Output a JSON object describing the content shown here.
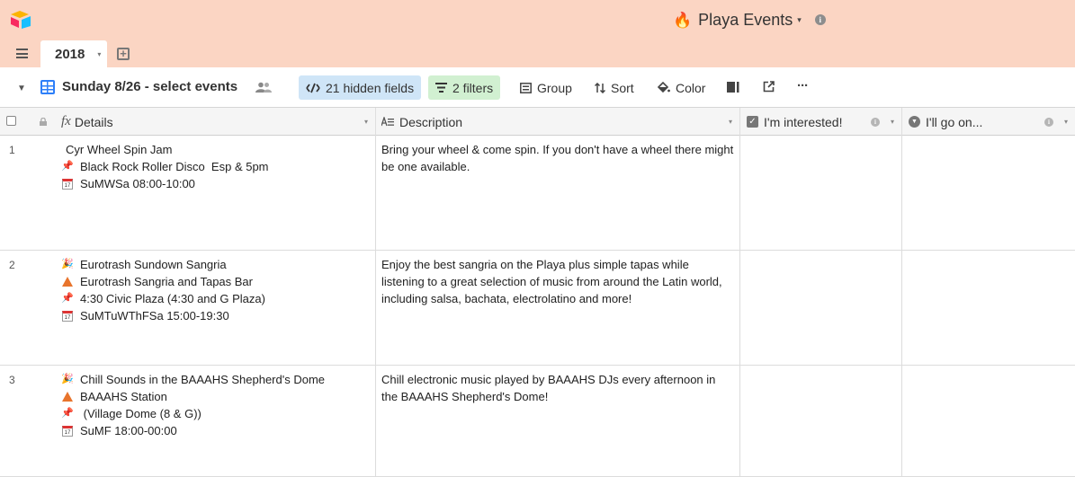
{
  "app": {
    "base_title": "Playa Events",
    "fire_emoji": "🔥",
    "caret": "▾",
    "info": "i"
  },
  "tabs": [
    {
      "label": "2018",
      "caret": "▾"
    }
  ],
  "add_table": "+",
  "view": {
    "collapse": "▼",
    "name": "Sunday 8/26 - select events",
    "hidden_fields_label": "21 hidden fields",
    "filters_label": "2 filters",
    "group_label": "Group",
    "sort_label": "Sort",
    "color_label": "Color",
    "more": "···"
  },
  "columns": [
    {
      "label": "Details",
      "icon": "fx",
      "dropdown": "▾"
    },
    {
      "label": "Description",
      "dropdown": "▾"
    },
    {
      "label": "I'm interested!",
      "info": "i",
      "dropdown": "▾"
    },
    {
      "label": "I'll go on...",
      "info": "i",
      "dropdown": "▾"
    }
  ],
  "rows": [
    {
      "num": "1",
      "details": [
        {
          "icon": "none",
          "text": "Cyr Wheel Spin Jam"
        },
        {
          "icon": "pushpin",
          "text": "Black Rock Roller Disco  Esp & 5pm"
        },
        {
          "icon": "calendar",
          "text": "SuMWSa 08:00-10:00"
        }
      ],
      "description": "Bring your wheel & come spin.  If you don't have a wheel there might be one available."
    },
    {
      "num": "2",
      "details": [
        {
          "icon": "party-popper",
          "text": "Eurotrash Sundown Sangria"
        },
        {
          "icon": "tent",
          "text": "Eurotrash Sangria and Tapas Bar"
        },
        {
          "icon": "pushpin",
          "text": "4:30 Civic Plaza (4:30 and G Plaza)"
        },
        {
          "icon": "calendar",
          "text": "SuMTuWThFSa 15:00-19:30"
        }
      ],
      "description": "Enjoy the best sangria on the Playa plus simple tapas while listening to a great selection of music from around the Latin world, including salsa, bachata, electrolatino and more!"
    },
    {
      "num": "3",
      "details": [
        {
          "icon": "party-popper",
          "text": "Chill Sounds in the BAAAHS Shepherd's Dome"
        },
        {
          "icon": "tent",
          "text": "BAAAHS Station"
        },
        {
          "icon": "pushpin",
          "text": " (Village Dome (8 & G))"
        },
        {
          "icon": "calendar",
          "text": "SuMF 18:00-00:00"
        }
      ],
      "description": "Chill electronic music played by BAAAHS DJs every afternoon in the BAAAHS Shepherd's Dome!"
    }
  ],
  "colors": {
    "topbar": "#fbd5c3",
    "hidden_fields_pill": "#cfe5f7",
    "filters_pill": "#d1f0d1",
    "accent_blue": "#2d7ff9"
  }
}
